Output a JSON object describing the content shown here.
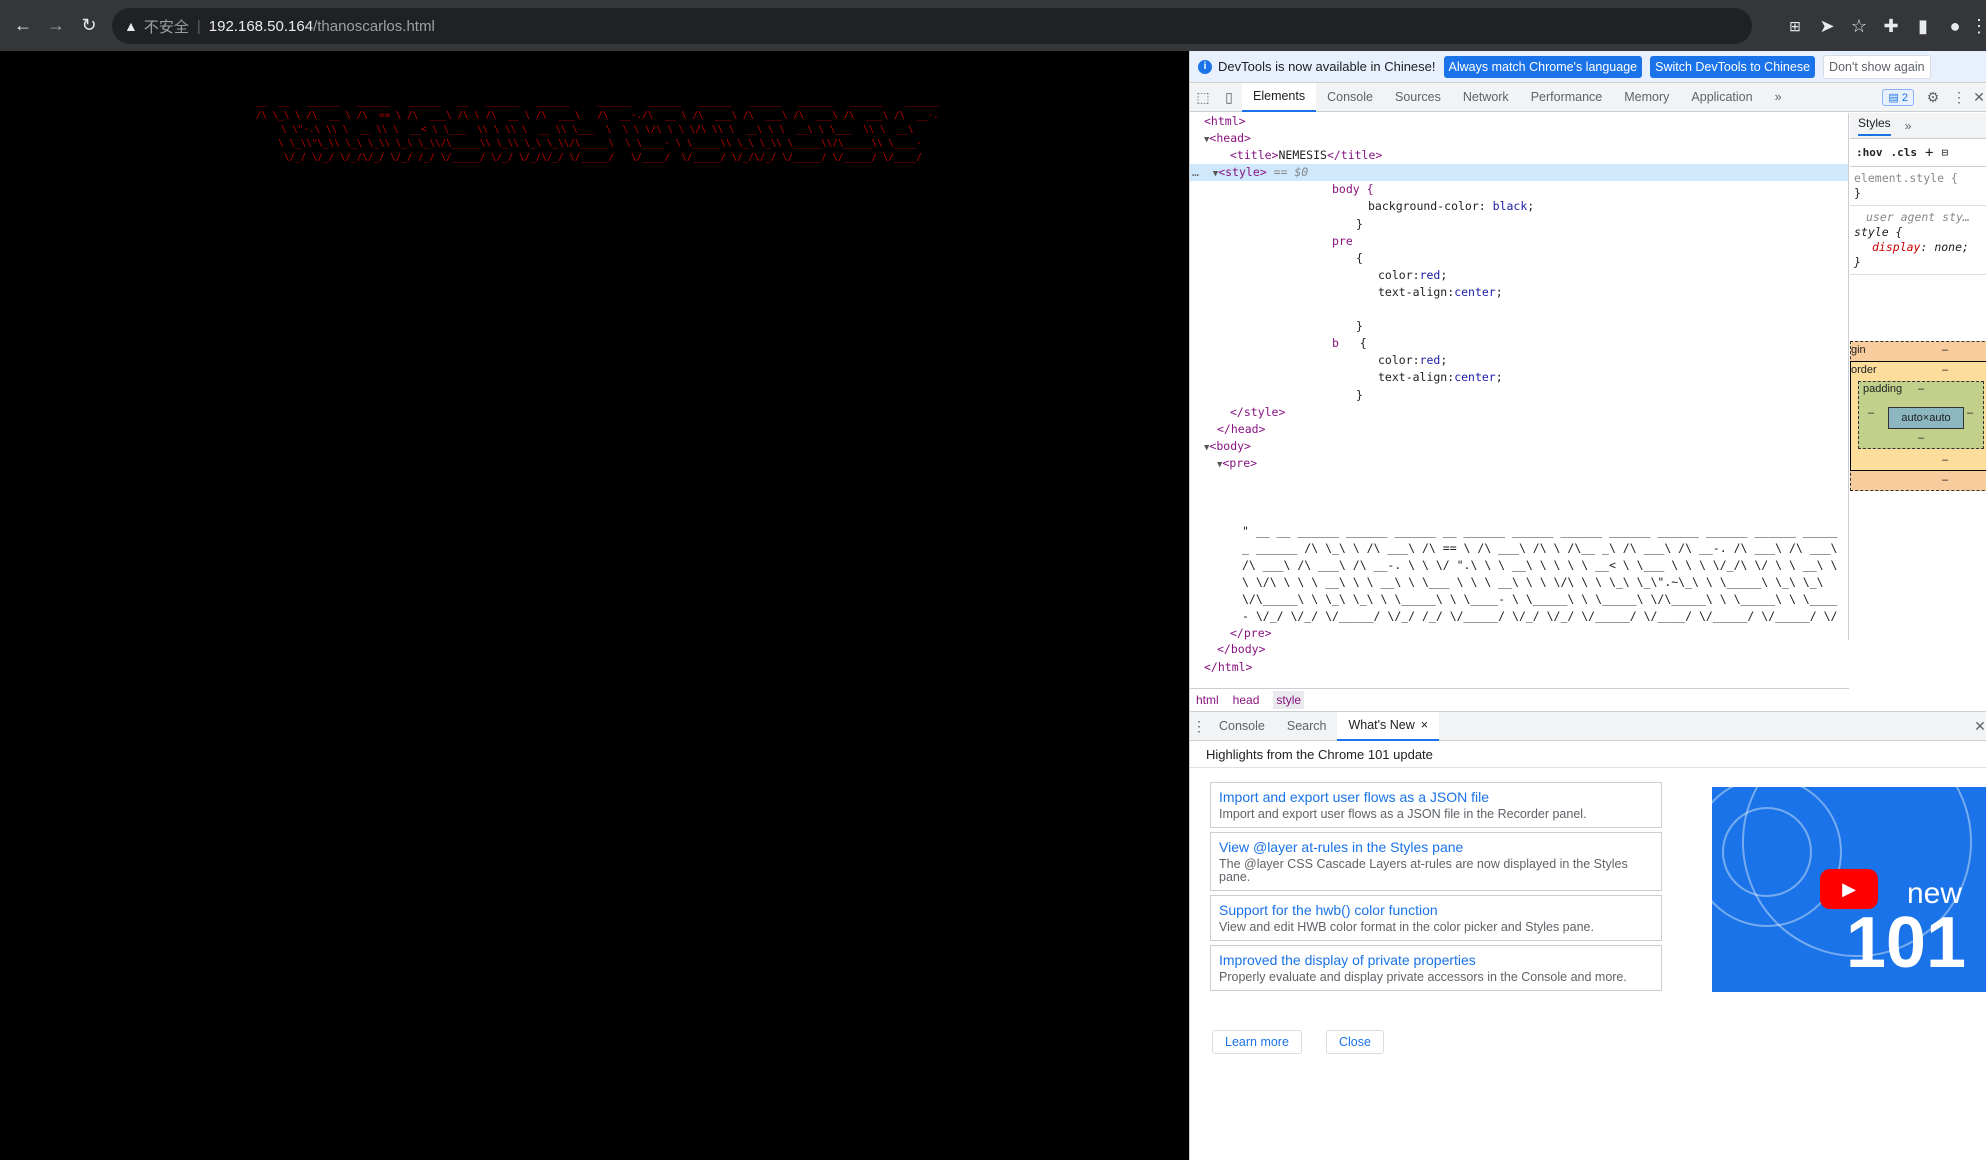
{
  "browser": {
    "insecure_label": "不安全",
    "url_host": "192.168.50.164",
    "url_path": "/thanoscarlos.html"
  },
  "page": {
    "ascii_art": " __  __   ______   ______   ______   __   ______   ______     ______   ______   ______   ______   ______   ______    ______\n /\\ \\_\\ \\ /\\  __ \\ /\\  == \\ /\\  ___\\ /\\ \\ /\\  __ \\ /\\  ___\\   /\\  __-./\\  __ \\ /\\  ___\\ /\\  ___\\ /\\  ___\\ /\\  ___\\ /\\  __-.\n \\ \\\"-.\\ \\\\ \\  __ \\\\ \\  __< \\ \\___  \\\\ \\ \\\\ \\  __ \\\\ \\___  \\  \\ \\ \\/\\ \\ \\ \\/\\ \\\\ \\  __\\ \\ \\  __\\ \\ \\___  \\\\ \\  __\\\n  \\ \\_\\\\\"\\_\\\\ \\_\\ \\_\\\\ \\_\\ \\_\\\\/\\_____\\\\ \\_\\\\ \\_\\ \\_\\\\/\\_____\\  \\ \\____- \\ \\_____\\\\ \\_\\ \\_\\\\ \\_____\\\\/\\_____\\\\ \\____-\n   \\/_/ \\/_/ \\/_/\\/_/ \\/_/ /_/ \\/_____/ \\/_/ \\/_/\\/_/ \\/_____/   \\/____/  \\/_____/ \\/_/\\/_/ \\/_____/ \\/_____/ \\/____/"
  },
  "devtools": {
    "infobar": {
      "message": "DevTools is now available in Chinese!",
      "btn_match": "Always match Chrome's language",
      "btn_switch": "Switch DevTools to Chinese",
      "btn_dont": "Don't show again"
    },
    "tabs": [
      "Elements",
      "Console",
      "Sources",
      "Network",
      "Performance",
      "Memory",
      "Application"
    ],
    "more_tabs": "»",
    "issues_count": "2",
    "elements": {
      "html_open": "<html>",
      "head_open": "<head>",
      "title_open": "<title>",
      "title_text": "NEMESIS",
      "title_close": "</title>",
      "style_open": "<style>",
      "style_eq": "== $0",
      "css_body_sel": "body {",
      "css_bg_prop": "background-color",
      "css_bg_val": "black",
      "close_brace": "}",
      "css_pre_sel": "pre",
      "open_brace": "{",
      "css_color_prop": "color",
      "css_color_val": "red",
      "css_ta_prop": "text-align",
      "css_ta_val": "center",
      "css_b_sel": "b",
      "style_close": "</style>",
      "head_close": "</head>",
      "body_open": "<body>",
      "pre_open": "<pre>",
      "pre_text": "\" __ __ ______ ______ ______ __ ______ ______ ______ ______ ______ ______ ______ ______ ______ /\\ \\_\\ \\ /\\ ___\\ /\\ == \\ /\\ ___\\ /\\ \\ /\\__ _\\ /\\ ___\\ /\\ __-. /\\ ___\\ /\\ ___\\ /\\ ___\\ /\\ ___\\ /\\ __-. \\ \\ \\/ \".\\ \\ \\ __\\ \\ \\ \\ \\ __< \\ \\___ \\ \\ \\ \\/_/\\ \\/ \\ \\ __\\ \\ \\ \\/\\ \\ \\ \\ __\\ \\ \\ __\\ \\ \\___ \\ \\ \\ __\\ \\ \\ \\/\\ \\ \\ \\_\\ \\_\\\".~\\_\\ \\ \\_____\\ \\_\\ \\_\\ \\/\\_____\\ \\ \\_\\ \\_\\ \\ \\_____\\ \\ \\____- \\ \\_____\\ \\ \\_____\\ \\/\\_____\\ \\ \\_____\\ \\ \\____- \\/_/ \\/_/ \\/_____/ \\/_/ /_/ \\/_____/ \\/_/ \\/_/ \\/_____/ \\/____/ \\/_____/ \\/_____/ \\/_____/ \\/_____/ \\/____/ \"",
      "pre_close": "</pre>",
      "body_close": "</body>",
      "html_close": "</html>"
    },
    "breadcrumbs": [
      "html",
      "head",
      "style"
    ],
    "styles": {
      "tab": "Styles",
      "more": "»",
      "hov": ":hov",
      "cls": ".cls",
      "plus": "+",
      "element_style": "element.style {",
      "close": "}",
      "ua_comment": "user agent sty…",
      "style_sel": "style {",
      "display_prop": "display",
      "display_val": "none;",
      "bm_margin": "gin",
      "bm_border": "order",
      "bm_padding": "padding",
      "bm_dash": "–",
      "bm_content": "auto×auto"
    },
    "drawer": {
      "tabs": [
        "Console",
        "Search",
        "What's New"
      ],
      "close_x": "×",
      "highlights": "Highlights from the Chrome 101 update",
      "cards": [
        {
          "title": "Import and export user flows as a JSON file",
          "desc": "Import and export user flows as a JSON file in the Recorder panel."
        },
        {
          "title": "View @layer at-rules in the Styles pane",
          "desc": "The @layer CSS Cascade Layers at-rules are now displayed in the Styles pane."
        },
        {
          "title": "Support for the hwb() color function",
          "desc": "View and edit HWB color format in the color picker and Styles pane."
        },
        {
          "title": "Improved the display of private properties",
          "desc": "Properly evaluate and display private accessors in the Console and more."
        }
      ],
      "video_new": "new",
      "video_num": "101",
      "learn_more": "Learn more",
      "close_btn": "Close"
    }
  }
}
